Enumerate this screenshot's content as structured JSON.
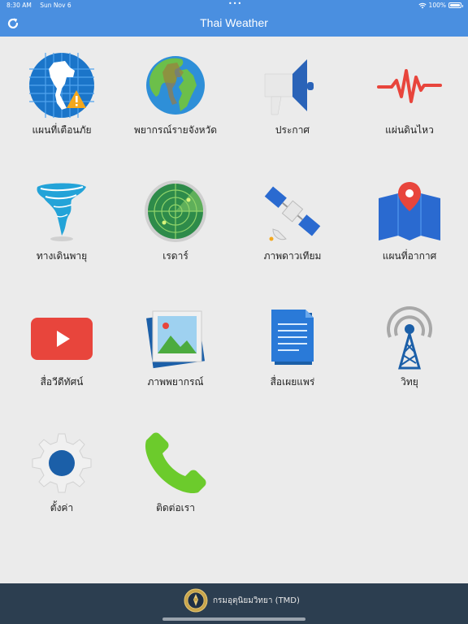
{
  "status_bar": {
    "time": "8:30 AM",
    "date": "Sun Nov 6",
    "dots": "•••",
    "battery": "100%"
  },
  "nav": {
    "title": "Thai Weather"
  },
  "tiles": [
    {
      "label": "แผนที่เตือนภัย",
      "icon": "warning-map-icon"
    },
    {
      "label": "พยากรณ์รายจังหวัด",
      "icon": "globe-icon"
    },
    {
      "label": "ประกาศ",
      "icon": "megaphone-icon"
    },
    {
      "label": "แผ่นดินไหว",
      "icon": "earthquake-pulse-icon"
    },
    {
      "label": "ทางเดินพายุ",
      "icon": "tornado-icon"
    },
    {
      "label": "เรดาร์",
      "icon": "radar-icon"
    },
    {
      "label": "ภาพดาวเทียม",
      "icon": "satellite-icon"
    },
    {
      "label": "แผนที่อากาศ",
      "icon": "map-pin-icon"
    },
    {
      "label": "สื่อวีดีทัศน์",
      "icon": "video-play-icon"
    },
    {
      "label": "ภาพพยากรณ์",
      "icon": "picture-icon"
    },
    {
      "label": "สื่อเผยแพร่",
      "icon": "document-icon"
    },
    {
      "label": "วิทยุ",
      "icon": "radio-tower-icon"
    },
    {
      "label": "ตั้งค่า",
      "icon": "gear-icon"
    },
    {
      "label": "ติดต่อเรา",
      "icon": "phone-icon"
    }
  ],
  "footer": {
    "text": "กรมอุตุนิยมวิทยา (TMD)"
  },
  "colors": {
    "header": "#4a8fe0",
    "background": "#ebebeb",
    "footer": "#2c3e50"
  }
}
